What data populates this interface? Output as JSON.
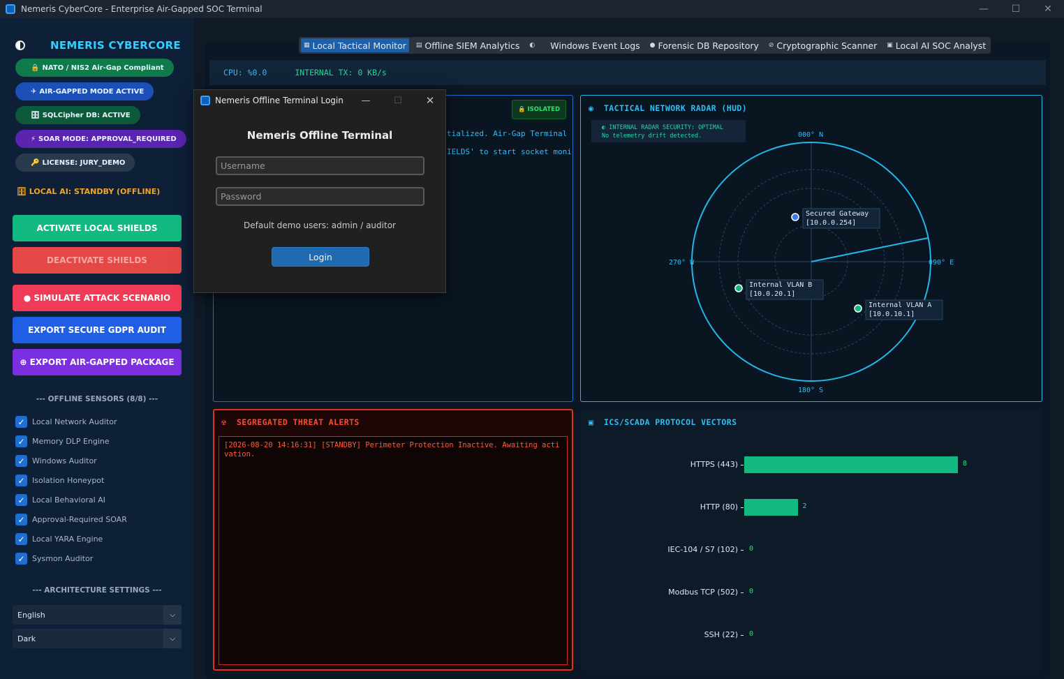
{
  "window": {
    "title": "Nemeris CyberCore - Enterprise Air-Gapped SOC Terminal",
    "minimize": "—",
    "maximize": "☐",
    "close": "✕"
  },
  "sidebar": {
    "brand": "NEMERIS CYBERCORE",
    "pills": [
      {
        "icon": "🔒",
        "label": "NATO / NIS2 Air-Gap Compliant",
        "color": "#0f7a4a"
      },
      {
        "icon": "✈",
        "label": "AIR-GAPPED MODE ACTIVE",
        "color": "#1d4fb8"
      },
      {
        "icon": "🗄",
        "label": "SQLCipher DB: ACTIVE",
        "color": "#0d5a3a"
      },
      {
        "icon": "⚡",
        "label": "SOAR MODE: APPROVAL_REQUIRED",
        "color": "#5a23b0"
      },
      {
        "icon": "🔑",
        "label": "LICENSE: JURY_DEMO",
        "color": "#2a3a4d"
      }
    ],
    "ai_status": "🗄 LOCAL AI: STANDBY (OFFLINE)",
    "buttons": {
      "activate": "ACTIVATE LOCAL SHIELDS",
      "deactivate": "DEACTIVATE SHIELDS",
      "simulate": "● SIMULATE ATTACK SCENARIO",
      "export_gdpr": "EXPORT SECURE GDPR AUDIT",
      "export_pkg": "⊕ EXPORT AIR-GAPPED PACKAGE"
    },
    "sensors_title": "--- OFFLINE SENSORS (8/8) ---",
    "sensors": [
      "Local Network Auditor",
      "Memory DLP Engine",
      "Windows Auditor",
      "Isolation Honeypot",
      "Local Behavioral AI",
      "Approval-Required SOAR",
      "Local YARA Engine",
      "Sysmon Auditor"
    ],
    "arch_title": "--- ARCHITECTURE SETTINGS ---",
    "language": "English",
    "theme": "Dark",
    "colors": {
      "activate": "#12b981",
      "deactivate": "#e54646",
      "simulate": "#ef3b55",
      "export_gdpr": "#1f5fe6",
      "export_pkg": "#7b2fe0"
    }
  },
  "tabs": [
    {
      "icon": "▦",
      "label": "Local Tactical Monitor"
    },
    {
      "icon": "▤",
      "label": "Offline SIEM Analytics"
    },
    {
      "icon": "◐",
      "label": ""
    },
    {
      "icon": "",
      "label": "Windows Event Logs"
    },
    {
      "icon": "●",
      "label": "Forensic DB Repository"
    },
    {
      "icon": "⊘",
      "label": "Cryptographic Scanner"
    },
    {
      "icon": "▣",
      "label": "Local AI SOC Analyst"
    }
  ],
  "status": {
    "cpu": "CPU: %0.0",
    "tx": "INTERNAL TX: 0 KB/s"
  },
  "terminal": {
    "badge": "🔒 ISOLATED",
    "line1": "tialized. Air-Gap Terminal",
    "line2": "IELDS' to start socket moni"
  },
  "radar": {
    "title": "TACTICAL NETWORK RADAR (HUD)",
    "security_line1": "◐   INTERNAL RADAR SECURITY: OPTIMAL",
    "security_line2": "No telemetry drift detected.",
    "north": "000° N",
    "east": "090° E",
    "south": "180° S",
    "west": "270° W",
    "nodes": [
      {
        "name": "Secured Gateway",
        "ip": "[10.0.0.254]",
        "color": "#3a7cf0"
      },
      {
        "name": "Internal VLAN B",
        "ip": "[10.0.20.1]",
        "color": "#12b981"
      },
      {
        "name": "Internal VLAN A",
        "ip": "[10.0.10.1]",
        "color": "#12b981"
      }
    ]
  },
  "alerts": {
    "title": "SEGREGATED THREAT ALERTS",
    "icon": "☢",
    "entries": [
      "[2026-08-20 14:16:31] [STANDBY] Perimeter Protection Inactive. Awaiting activation."
    ]
  },
  "ics": {
    "title": "ICS/SCADA PROTOCOL VECTORS",
    "icon": "▣"
  },
  "chart_data": {
    "type": "bar",
    "title": "ICS/SCADA PROTOCOL VECTORS",
    "orientation": "horizontal",
    "categories": [
      "HTTPS (443)",
      "HTTP (80)",
      "IEC-104 / S7 (102)",
      "Modbus TCP (502)",
      "SSH (22)"
    ],
    "values": [
      8,
      2,
      0,
      0,
      0
    ],
    "color": "#12b981",
    "xlim": [
      0,
      8
    ]
  },
  "login": {
    "title": "Nemeris Offline Terminal Login",
    "heading": "Nemeris Offline Terminal",
    "username_placeholder": "Username",
    "password_placeholder": "Password",
    "hint": "Default demo users: admin / auditor",
    "button": "Login"
  }
}
